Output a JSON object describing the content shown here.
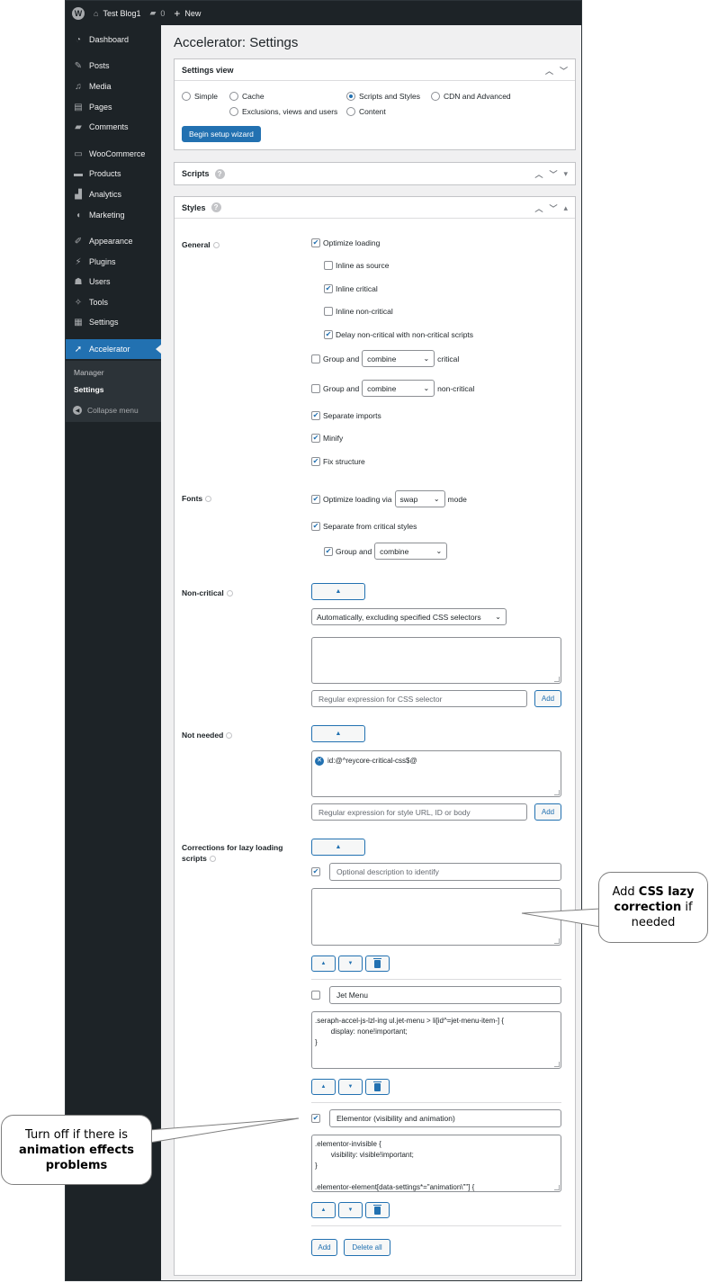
{
  "admin_bar": {
    "site_name": "Test Blog1",
    "comments_count": "0",
    "new_label": "New"
  },
  "sidebar": {
    "items": [
      {
        "label": "Dashboard",
        "icon": "dashboard-icon"
      },
      {
        "label": "Posts",
        "icon": "pin-icon"
      },
      {
        "label": "Media",
        "icon": "media-icon"
      },
      {
        "label": "Pages",
        "icon": "pages-icon"
      },
      {
        "label": "Comments",
        "icon": "comment-icon"
      },
      {
        "label": "WooCommerce",
        "icon": "woo-icon"
      },
      {
        "label": "Products",
        "icon": "archive-icon"
      },
      {
        "label": "Analytics",
        "icon": "chart-icon"
      },
      {
        "label": "Marketing",
        "icon": "megaphone-icon"
      },
      {
        "label": "Appearance",
        "icon": "brush-icon"
      },
      {
        "label": "Plugins",
        "icon": "plug-icon"
      },
      {
        "label": "Users",
        "icon": "user-icon"
      },
      {
        "label": "Tools",
        "icon": "wrench-icon"
      },
      {
        "label": "Settings",
        "icon": "sliders-icon"
      },
      {
        "label": "Accelerator",
        "icon": "accelerator-icon"
      }
    ],
    "submenu": [
      "Manager",
      "Settings"
    ],
    "collapse_label": "Collapse menu"
  },
  "page": {
    "title": "Accelerator: Settings"
  },
  "settings_view": {
    "title": "Settings view",
    "options": [
      {
        "label": "Simple",
        "selected": false
      },
      {
        "label": "Cache",
        "selected": false
      },
      {
        "label": "Scripts and Styles",
        "selected": true
      },
      {
        "label": "CDN and Advanced",
        "selected": false
      },
      {
        "label": "Exclusions, views and users",
        "selected": false
      },
      {
        "label": "Content",
        "selected": false
      }
    ],
    "wizard_button": "Begin setup wizard"
  },
  "scripts_box": {
    "title": "Scripts"
  },
  "styles_box": {
    "title": "Styles",
    "general": {
      "label": "General",
      "optimize_loading": {
        "label": "Optimize loading",
        "checked": true
      },
      "inline_as_source": {
        "label": "Inline as source",
        "checked": false
      },
      "inline_critical": {
        "label": "Inline critical",
        "checked": true
      },
      "inline_non_critical": {
        "label": "Inline non-critical",
        "checked": false
      },
      "delay_non_critical": {
        "label": "Delay non-critical with non-critical scripts",
        "checked": true
      },
      "group_critical": {
        "label": "Group and",
        "select": "combine",
        "suffix": "critical",
        "checked": false
      },
      "group_non_critical": {
        "label": "Group and",
        "select": "combine",
        "suffix": "non-critical",
        "checked": false
      },
      "separate_imports": {
        "label": "Separate imports",
        "checked": true
      },
      "minify": {
        "label": "Minify",
        "checked": true
      },
      "fix_structure": {
        "label": "Fix structure",
        "checked": true
      }
    },
    "fonts": {
      "label": "Fonts",
      "optimize_loading": {
        "label": "Optimize loading via",
        "select": "swap",
        "suffix": "mode",
        "checked": true
      },
      "separate": {
        "label": "Separate from critical styles",
        "checked": true
      },
      "group": {
        "label": "Group and",
        "select": "combine",
        "checked": true
      }
    },
    "non_critical": {
      "label": "Non-critical",
      "mode_select": "Automatically, excluding specified CSS selectors",
      "textarea_value": "",
      "regex_placeholder": "Regular expression for CSS selector",
      "add_label": "Add"
    },
    "not_needed": {
      "label": "Not needed",
      "items": [
        "id:@^reycore-critical-css$@"
      ],
      "regex_placeholder": "Regular expression for style URL, ID or body",
      "add_label": "Add"
    },
    "corrections": {
      "label": "Corrections for lazy loading scripts",
      "items": [
        {
          "checked": true,
          "description": "",
          "description_placeholder": "Optional description to identify",
          "code": ""
        },
        {
          "checked": false,
          "description": "Jet Menu",
          "description_placeholder": "Optional description to identify",
          "code": ".seraph-accel-js-lzl-ing ul.jet-menu > li[id^=jet-menu-item-] {\n        display: none!important;\n}"
        },
        {
          "checked": true,
          "description": "Elementor (visibility and animation)",
          "description_placeholder": "Optional description to identify",
          "code": ".elementor-invisible {\n        visibility: visible!important;\n}\n\n.elementor-element[data-settings*=\"animation\\\"\"] {"
        }
      ],
      "add_label": "Add",
      "delete_all_label": "Delete all"
    }
  },
  "callouts": {
    "lazy_correction": {
      "pre": "Add ",
      "bold": "CSS lazy correction",
      "post": " if needed"
    },
    "animation": {
      "pre": "Turn off if there is ",
      "bold": "animation effects problems",
      "post": ""
    }
  }
}
